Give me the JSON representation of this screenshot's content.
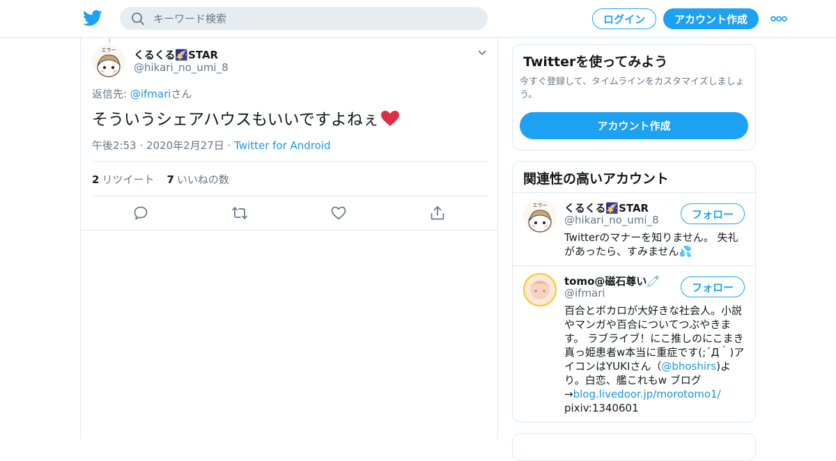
{
  "header": {
    "search_placeholder": "キーワード検索",
    "login_label": "ログイン",
    "signup_label": "アカウント作成"
  },
  "tweet": {
    "author_name": "くるくる🌠STAR",
    "author_handle": "@hikari_no_umi_8",
    "reply_prefix": "返信先: ",
    "reply_handle": "@ifmari",
    "reply_suffix": "さん",
    "text": "そういうシェアハウスもいいですよねぇ",
    "time": "午後2:53 · 2020年2月27日 · ",
    "source": "Twitter for Android",
    "retweet_count": "2",
    "retweet_label": "リツイート",
    "like_count": "7",
    "like_label": "いいねの数"
  },
  "signup_card": {
    "title": "Twitterを使ってみよう",
    "description": "今すぐ登録して、タイムラインをカスタマイズしましょう。",
    "button_label": "アカウント作成"
  },
  "related": {
    "title": "関連性の高いアカウント",
    "accounts": [
      {
        "name": "くるくる🌠STAR",
        "handle": "@hikari_no_umi_8",
        "follow_label": "フォロー",
        "bio": "Twitterのマナーを知りません。 失礼があったら、すみません💦"
      },
      {
        "name": "tomo@磁石尊い🧷",
        "handle": "@ifmari",
        "follow_label": "フォロー",
        "bio_part1": "百合とボカロが大好きな社会人。小説やマンガや百合についてつぶやきます。 ラブライブ！にこ推しのにこまき真っ姫患者w本当に重症です(;´Д｀)アイコンはYUKIさん（",
        "bio_link1": "@bhoshirs",
        "bio_part2": ")より。白恋、艦これもw ブログ→",
        "bio_link2": "blog.livedoor.jp/morotomo1/",
        "bio_part3": " pixiv:1340601"
      }
    ]
  },
  "colors": {
    "brand_blue": "#1da1f2",
    "link_blue": "#1b95e0",
    "muted_text": "#657786",
    "border": "#e1e8ed",
    "heart_red": "#e0245e"
  }
}
